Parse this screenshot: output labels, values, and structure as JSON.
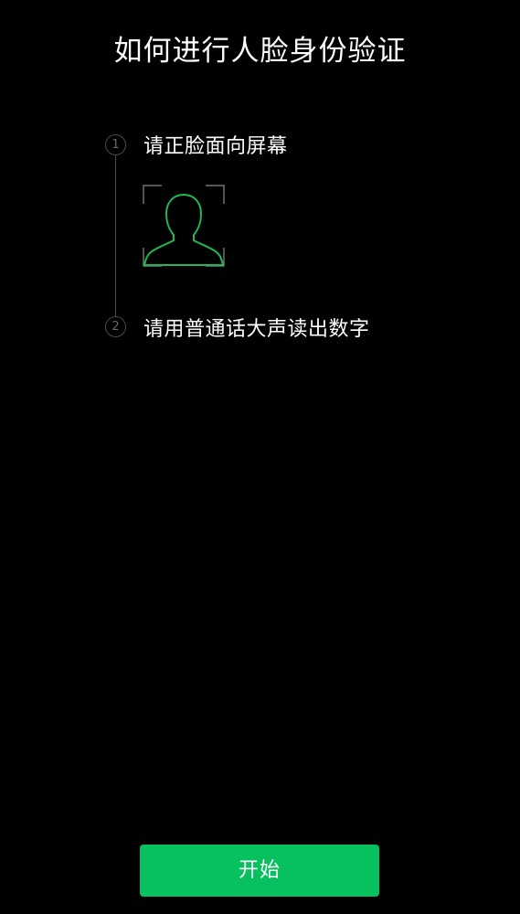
{
  "page": {
    "title": "如何进行人脸身份验证"
  },
  "steps": [
    {
      "number": "1",
      "text": "请正脸面向屏幕",
      "icon": "face-outline-icon"
    },
    {
      "number": "2",
      "text": "请用普通话大声读出数字"
    }
  ],
  "start_button": {
    "label": "开始"
  },
  "colors": {
    "background": "#000000",
    "accent_green": "#07c160",
    "face_outline": "#1db954",
    "step_gray": "#4a4a4a"
  }
}
